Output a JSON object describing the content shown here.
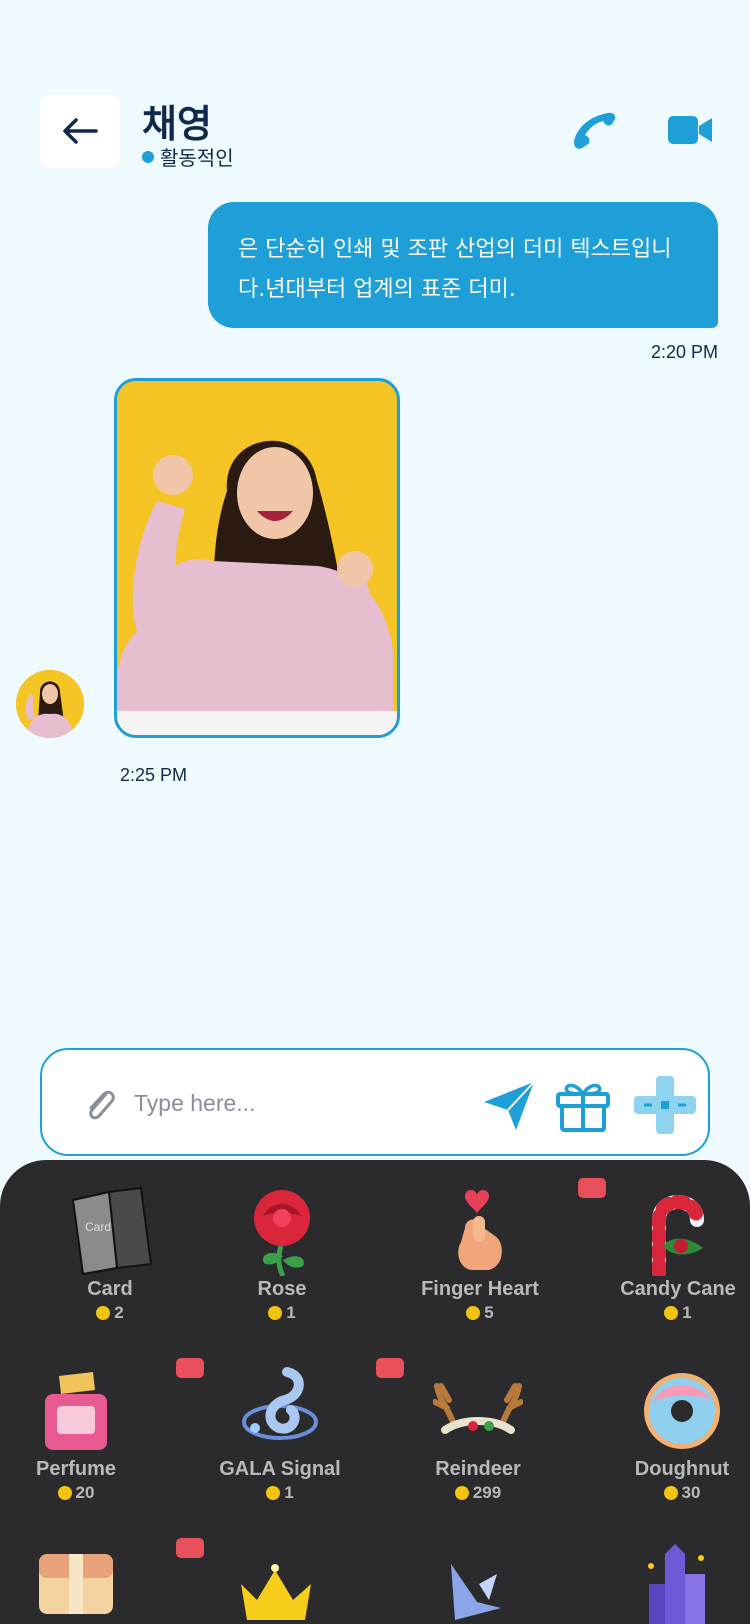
{
  "header": {
    "contact_name": "채영",
    "status": "활동적인"
  },
  "messages": [
    {
      "direction": "outgoing",
      "type": "text",
      "text": "은 단순히 인쇄 및 조판 산업의 더미 텍스트입니다.년대부터 업계의 표준 더미.",
      "time": "2:20 PM"
    },
    {
      "direction": "incoming",
      "type": "image",
      "time": "2:25 PM"
    }
  ],
  "composer": {
    "placeholder": "Type here..."
  },
  "gifts": [
    {
      "name": "Card",
      "price": "2",
      "icon": "card-icon"
    },
    {
      "name": "Rose",
      "price": "1",
      "icon": "rose-icon"
    },
    {
      "name": "Finger Heart",
      "price": "5",
      "icon": "finger-heart-icon"
    },
    {
      "name": "Candy Cane",
      "price": "1",
      "icon": "candy-cane-icon"
    },
    {
      "name": "Perfume",
      "price": "20",
      "icon": "perfume-icon"
    },
    {
      "name": "GALA Signal",
      "price": "1",
      "icon": "gala-signal-icon"
    },
    {
      "name": "Reindeer",
      "price": "299",
      "icon": "reindeer-icon"
    },
    {
      "name": "Doughnut",
      "price": "30",
      "icon": "doughnut-icon"
    },
    {
      "name": "",
      "price": "",
      "icon": "treasure-chest-icon"
    },
    {
      "name": "",
      "price": "",
      "icon": "crown-icon"
    },
    {
      "name": "",
      "price": "",
      "icon": "crystal-icon"
    },
    {
      "name": "",
      "price": "",
      "icon": "castle-icon"
    }
  ],
  "colors": {
    "accent": "#1e9fd8",
    "background": "#eefafd",
    "panel": "#2b2b2d",
    "coin": "#f2c40f"
  }
}
